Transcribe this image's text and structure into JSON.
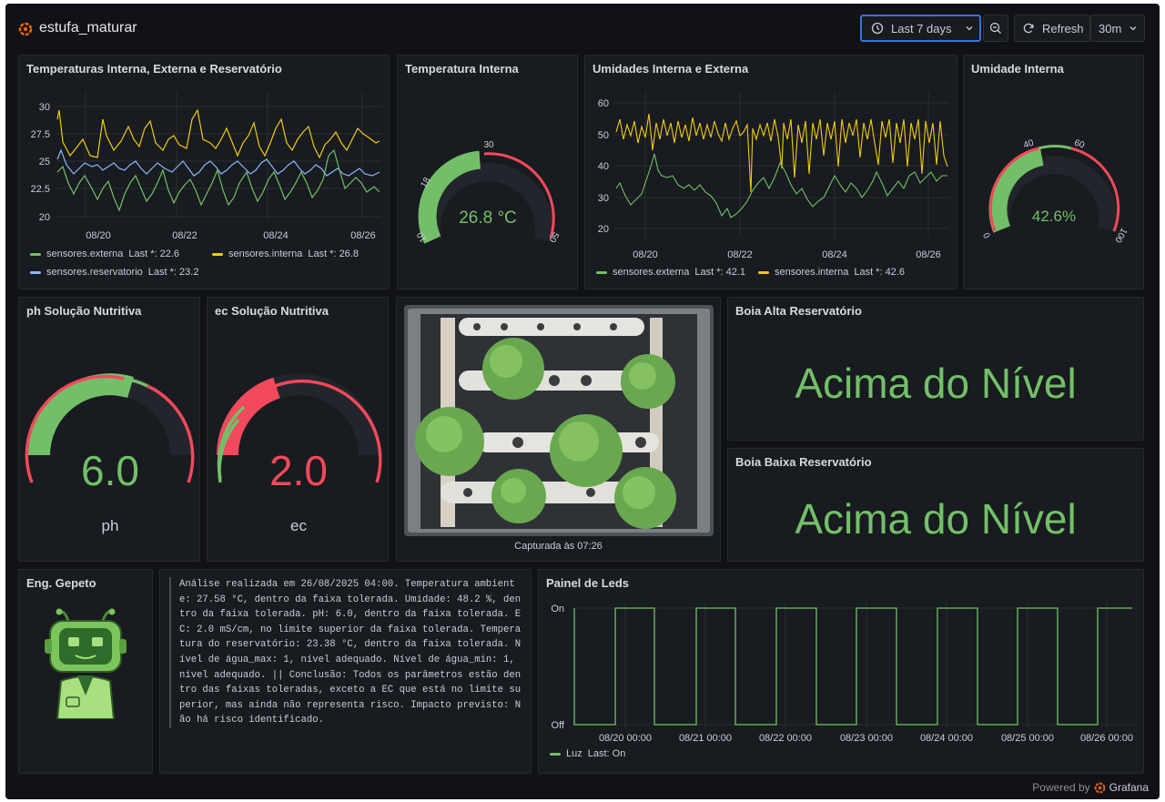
{
  "dashboard": {
    "title": "estufa_maturar"
  },
  "toolbar": {
    "time_range": "Last 7 days",
    "refresh_label": "Refresh",
    "refresh_interval": "30m"
  },
  "panels": {
    "temps": {
      "title": "Temperaturas Interna, Externa e Reservatório",
      "y_ticks": [
        "30",
        "27.5",
        "25",
        "22.5",
        "20"
      ],
      "x_ticks": [
        "08/20",
        "08/22",
        "08/24",
        "08/26"
      ],
      "legend": [
        {
          "name": "sensores.externa",
          "last": "Last *: 22.6",
          "color": "#73bf69"
        },
        {
          "name": "sensores.interna",
          "last": "Last *: 26.8",
          "color": "#f2cc0c"
        },
        {
          "name": "sensores.reservatorio",
          "last": "Last *: 23.2",
          "color": "#8ab8ff"
        }
      ]
    },
    "temp_interna": {
      "title": "Temperatura Interna",
      "value": "26.8 °C",
      "min": "10",
      "max": "50",
      "t1": "18",
      "t2": "30"
    },
    "umidades": {
      "title": "Umidades Interna e Externa",
      "y_ticks": [
        "60",
        "50",
        "40",
        "30",
        "20"
      ],
      "x_ticks": [
        "08/20",
        "08/22",
        "08/24",
        "08/26"
      ],
      "legend": [
        {
          "name": "sensores.externa",
          "last": "Last *: 42.1",
          "color": "#73bf69"
        },
        {
          "name": "sensores.interna",
          "last": "Last *: 42.6",
          "color": "#f2cc0c"
        }
      ]
    },
    "umid_interna": {
      "title": "Umidade Interna",
      "value": "42.6%",
      "min": "0",
      "max": "100",
      "t1": "40",
      "t2": "60"
    },
    "ph": {
      "title": "ph Solução Nutritiva",
      "value": "6.0",
      "label": "ph"
    },
    "ec": {
      "title": "ec Solução Nutritiva",
      "value": "2.0",
      "label": "ec"
    },
    "camera": {
      "caption": "Capturada às 07:26"
    },
    "boia_alta": {
      "title": "Boia Alta Reservatório",
      "status": "Acima do Nível"
    },
    "boia_baixa": {
      "title": "Boia Baixa Reservatório",
      "status": "Acima do Nível"
    },
    "eng": {
      "title": "Eng. Gepeto"
    },
    "analysis": {
      "text": "Análise realizada em 26/08/2025 04:00. Temperatura ambiente: 27.58 °C, dentro da faixa tolerada. Umidade: 48.2 %, dentro da faixa tolerada. pH: 6.0, dentro da faixa tolerada. EC: 2.0 mS/cm, no limite superior da faixa tolerada. Temperatura do reservatório: 23.38 °C, dentro da faixa tolerada. Nível de água_max: 1, nível adequado. Nível de água_min: 1, nível adequado. || Conclusão: Todos os parâmetros estão dentro das faixas toleradas, exceto a EC que está no limite superior, mas ainda não representa risco. Impacto previsto: Não há risco identificado."
    },
    "leds": {
      "title": "Painel de Leds",
      "y_ticks": [
        "On",
        "Off"
      ],
      "x_ticks": [
        "08/20 00:00",
        "08/21 00:00",
        "08/22 00:00",
        "08/23 00:00",
        "08/24 00:00",
        "08/25 00:00",
        "08/26 00:00"
      ],
      "legend_name": "Luz",
      "legend_last": "Last: On"
    }
  },
  "footer": {
    "powered": "Powered by",
    "brand": "Grafana"
  },
  "colors": {
    "green": "#73bf69",
    "yellow": "#f2cc0c",
    "blue": "#8ab8ff",
    "red": "#f2495c",
    "accent": "#3d71d9"
  }
}
